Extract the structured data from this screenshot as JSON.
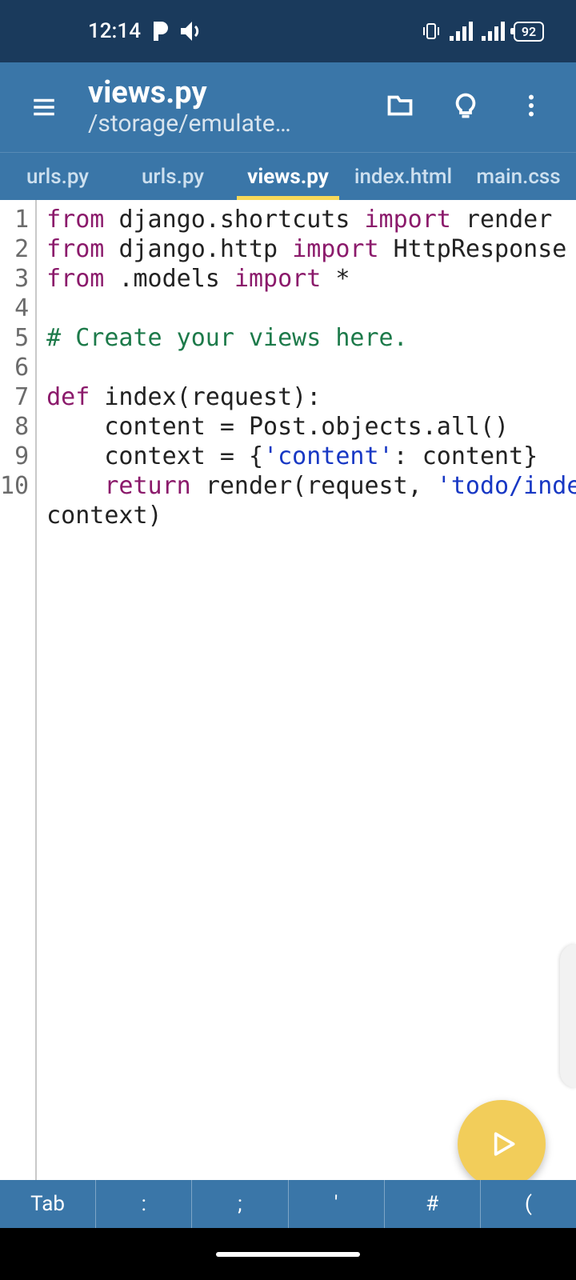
{
  "status": {
    "time": "12:14",
    "battery": "92"
  },
  "header": {
    "title": "views.py",
    "subtitle": "/storage/emulate…"
  },
  "tabs": [
    {
      "label": "urls.py",
      "active": false
    },
    {
      "label": "urls.py",
      "active": false
    },
    {
      "label": "views.py",
      "active": true
    },
    {
      "label": "index.html",
      "active": false
    },
    {
      "label": "main.css",
      "active": false
    }
  ],
  "code": {
    "lines": [
      {
        "n": "1",
        "tokens": [
          [
            "from ",
            "kw-purple"
          ],
          [
            "django.shortcuts ",
            ""
          ],
          [
            "import ",
            "kw-purple"
          ],
          [
            "render",
            ""
          ]
        ]
      },
      {
        "n": "2",
        "tokens": [
          [
            "from ",
            "kw-purple"
          ],
          [
            "django.http ",
            ""
          ],
          [
            "import ",
            "kw-purple"
          ],
          [
            "HttpResponse",
            ""
          ]
        ]
      },
      {
        "n": "3",
        "tokens": [
          [
            "from ",
            "kw-purple"
          ],
          [
            ".models ",
            ""
          ],
          [
            "import ",
            "kw-purple"
          ],
          [
            "*",
            ""
          ]
        ]
      },
      {
        "n": "4",
        "tokens": []
      },
      {
        "n": "5",
        "tokens": [
          [
            "# Create your views here.",
            "kw-green"
          ]
        ]
      },
      {
        "n": "6",
        "tokens": []
      },
      {
        "n": "7",
        "tokens": [
          [
            "def ",
            "kw-purple"
          ],
          [
            "index(request):",
            ""
          ]
        ]
      },
      {
        "n": "8",
        "tokens": [
          [
            "    content = Post.objects.all()",
            ""
          ]
        ]
      },
      {
        "n": "9",
        "tokens": [
          [
            "    context = {",
            ""
          ],
          [
            "'content'",
            "kw-blue"
          ],
          [
            ": content}",
            ""
          ]
        ]
      },
      {
        "n": "10",
        "tokens": [
          [
            "    ",
            ""
          ],
          [
            "return ",
            "kw-purple"
          ],
          [
            "render(request, ",
            ""
          ],
          [
            "'todo/index.html'",
            "kw-blue"
          ],
          [
            ",",
            ""
          ]
        ]
      },
      {
        "n": "",
        "tokens": [
          [
            "context)",
            ""
          ]
        ]
      }
    ]
  },
  "bottomKeys": [
    "Tab",
    ":",
    ";",
    "'",
    "#",
    "("
  ]
}
